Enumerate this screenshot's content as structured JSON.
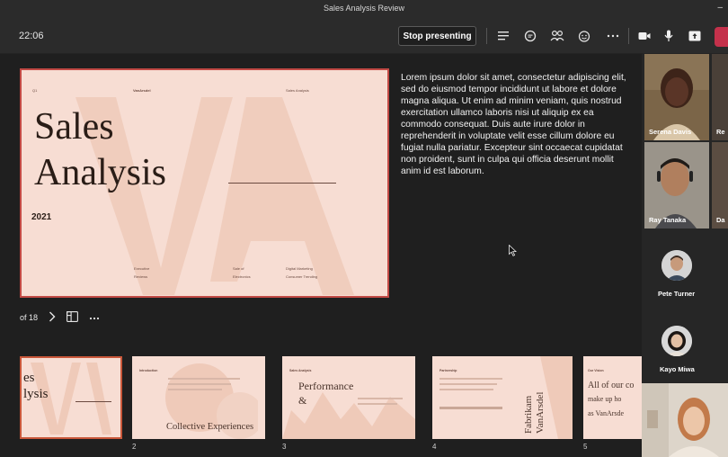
{
  "window": {
    "title": "Sales Analysis Review"
  },
  "toolbar": {
    "timer": "22:06",
    "stop_presenting_label": "Stop presenting"
  },
  "slide": {
    "label_q1": "Q1",
    "label_brand": "VanArsdel",
    "label_corner": "Sales Analysis",
    "title_line1": "Sales",
    "title_line2": "Analysis",
    "year": "2021",
    "footer": [
      {
        "line1": "Executive",
        "line2": "Reviews"
      },
      {
        "line1": "Sale of",
        "line2": "Electronics"
      },
      {
        "line1": "Digital Marketing",
        "line2": "Consumer Trending"
      }
    ]
  },
  "notes": {
    "text": "Lorem ipsum dolor sit amet, consectetur adipiscing elit, sed do eiusmod tempor incididunt ut labore et dolore magna aliqua. Ut enim ad minim veniam, quis nostrud exercitation ullamco laboris nisi ut aliquip ex ea commodo consequat. Duis aute irure dolor in reprehenderit in voluptate velit esse cillum dolore eu fugiat nulla pariatur. Excepteur sint occaecat cupidatat non proident, sunt in culpa qui officia deserunt mollit anim id est laborum."
  },
  "navigation": {
    "page_indicator": "of 18"
  },
  "thumbnails": [
    {
      "number": "",
      "title_line1": "es",
      "title_line2": "lysis"
    },
    {
      "number": "2",
      "heading": "Introduction",
      "big_text": "Collective Experiences"
    },
    {
      "number": "3",
      "heading": "Sales Analysis",
      "big_text": "Performance",
      "big_text2": "&"
    },
    {
      "number": "4",
      "heading": "Partnership",
      "big_text": "Fabrikam",
      "big_text2": "VanArsdel"
    },
    {
      "number": "5",
      "heading": "Our Vision",
      "big_text": "All of our co",
      "big_text2": "make up ho",
      "big_text3": "as VanArsde"
    }
  ],
  "participants": [
    {
      "name": "Serena Davis"
    },
    {
      "name": "Re"
    },
    {
      "name": "Ray Tanaka"
    },
    {
      "name": "Da"
    },
    {
      "name": "Pete Turner"
    },
    {
      "name": "Kayo Miwa"
    }
  ],
  "colors": {
    "slide_bg": "#f7ddd3",
    "slide_border": "#c24a45",
    "leave_button": "#c4314b",
    "app_bg": "#1f1f1f",
    "toolbar_bg": "#2b2b2b"
  },
  "icons": [
    "hamburger-icon",
    "chat-icon",
    "people-icon",
    "reactions-icon",
    "more-icon",
    "camera-icon",
    "mic-icon",
    "share-icon",
    "leave-icon",
    "chevron-right-icon",
    "grid-view-icon",
    "cursor-icon"
  ]
}
